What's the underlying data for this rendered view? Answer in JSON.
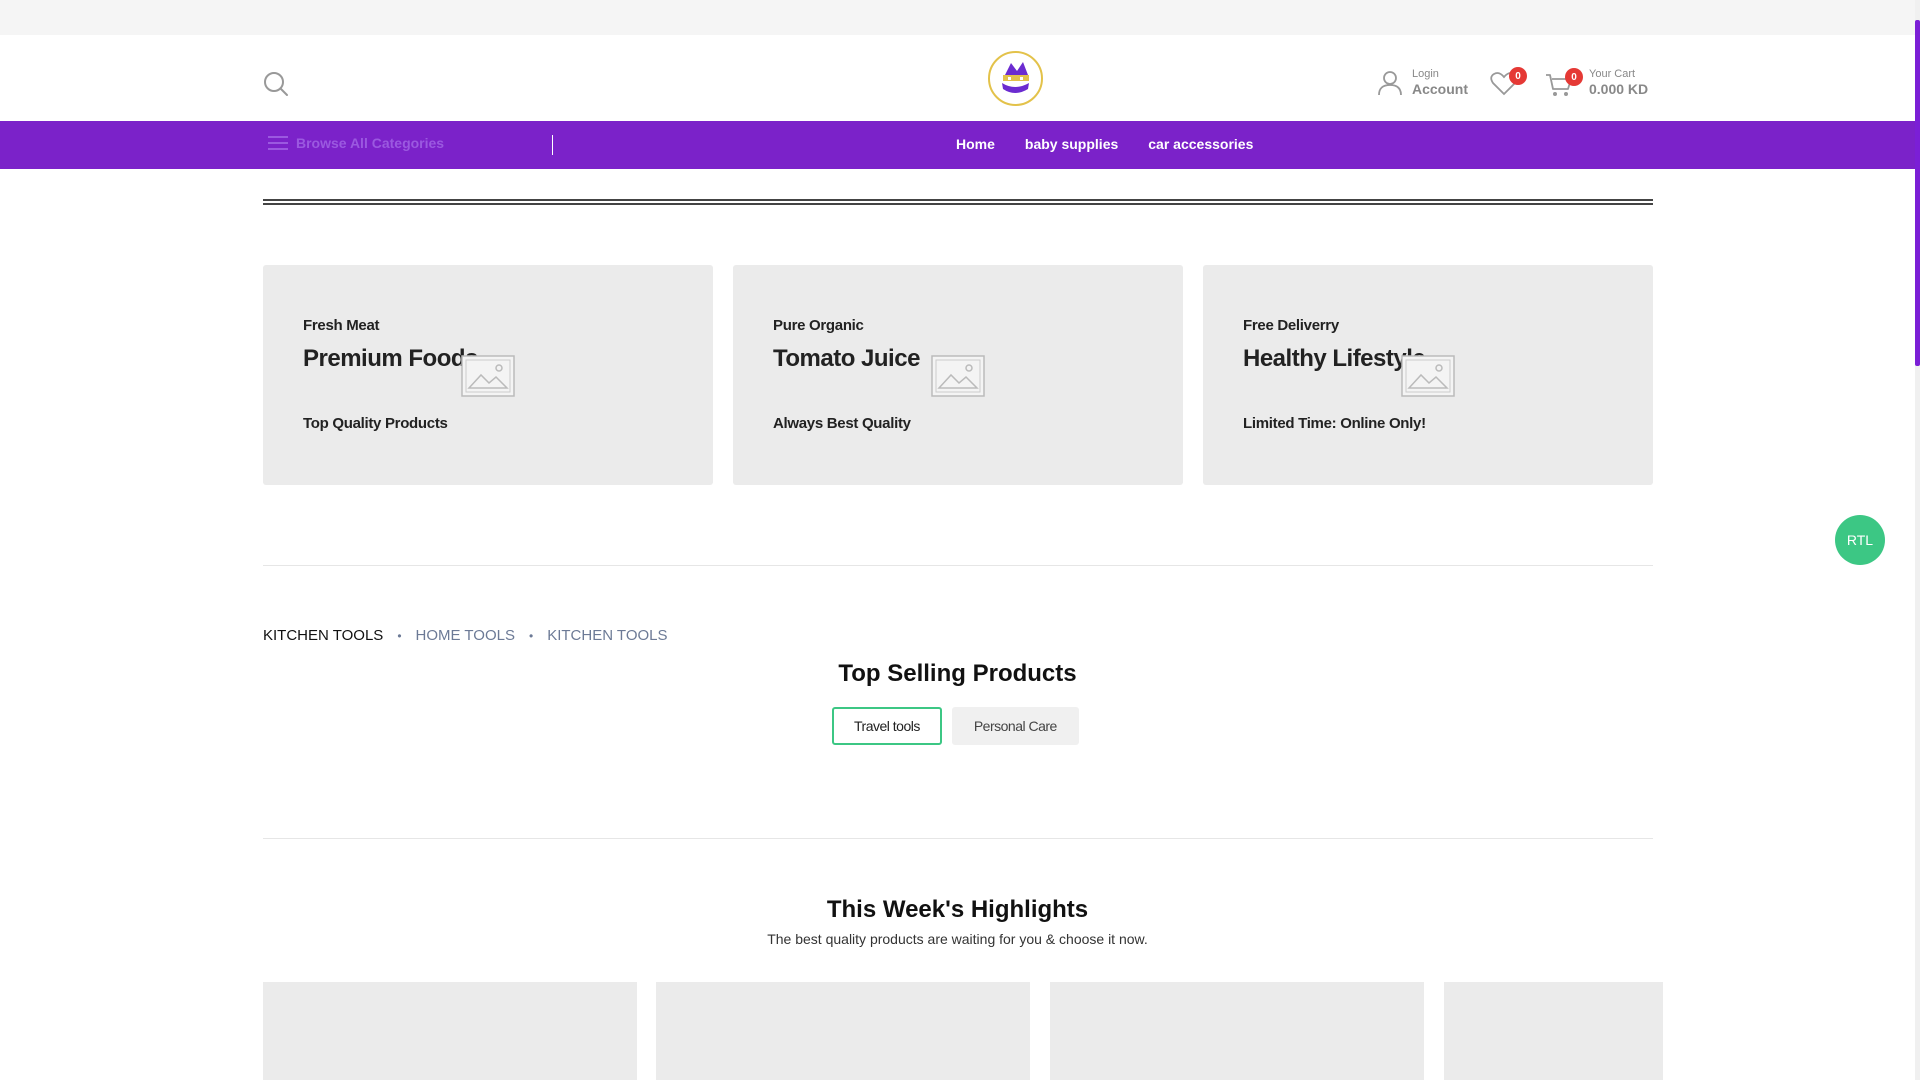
{
  "header": {
    "account": {
      "small": "Login",
      "big": "Account"
    },
    "wishlist_count": "0",
    "cart": {
      "count": "0",
      "small": "Your Cart",
      "total": "0.000 KD"
    }
  },
  "nav": {
    "browse_label": "Browse All Categories",
    "links": [
      "Home",
      "baby supplies",
      "car accessories"
    ]
  },
  "banners": [
    {
      "sub": "Fresh Meat",
      "title": "Premium Foods",
      "tag": "Top Quality Products"
    },
    {
      "sub": "Pure Organic",
      "title": "Tomato Juice",
      "tag": "Always Best Quality"
    },
    {
      "sub": "Free Deliverry",
      "title": "Healthy Lifestyle",
      "tag": "Limited Time: Online Only!"
    }
  ],
  "rtl_label": "RTL",
  "category_tabs": [
    "KITCHEN TOOLS",
    "HOME TOOLS",
    "KITCHEN TOOLS"
  ],
  "top_selling": {
    "title": "Top Selling Products",
    "pills": [
      "Travel tools",
      "Personal Care"
    ]
  },
  "highlights": {
    "title": "This Week's Highlights",
    "subtitle": "The best quality products are waiting for you & choose it now."
  },
  "colors": {
    "brand_purple": "#7b22c9",
    "accent_green": "#3cc784",
    "badge_red": "#e53935"
  }
}
